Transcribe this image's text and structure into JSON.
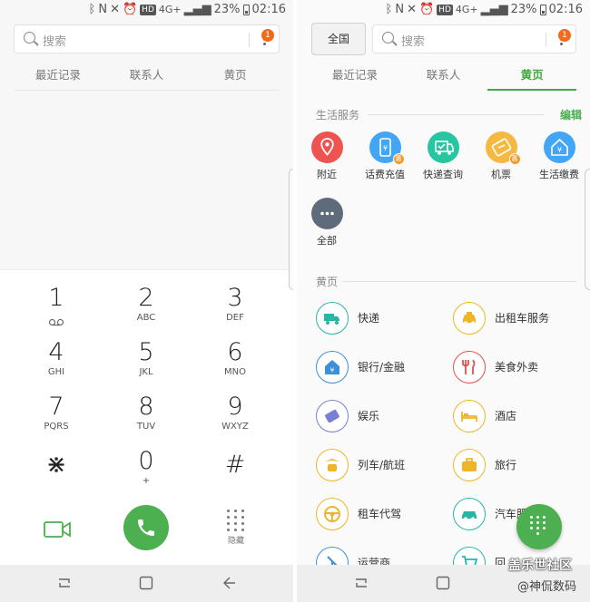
{
  "status": {
    "network": "4G+",
    "hd": "HD",
    "battery": "23%",
    "time": "02:16"
  },
  "search": {
    "placeholder": "搜索",
    "badge": "1"
  },
  "tabs": [
    {
      "label": "最近记录"
    },
    {
      "label": "联系人"
    },
    {
      "label": "黄页"
    }
  ],
  "dialpad": {
    "keys": [
      {
        "num": "1",
        "letters": ""
      },
      {
        "num": "2",
        "letters": "ABC"
      },
      {
        "num": "3",
        "letters": "DEF"
      },
      {
        "num": "4",
        "letters": "GHI"
      },
      {
        "num": "5",
        "letters": "JKL"
      },
      {
        "num": "6",
        "letters": "MNO"
      },
      {
        "num": "7",
        "letters": "PQRS"
      },
      {
        "num": "8",
        "letters": "TUV"
      },
      {
        "num": "9",
        "letters": "WXYZ"
      },
      {
        "num": "⋇",
        "letters": ""
      },
      {
        "num": "0",
        "letters": "+"
      },
      {
        "num": "#",
        "letters": ""
      }
    ],
    "hide_label": "隐藏"
  },
  "right": {
    "region_button": "全国",
    "life_services_title": "生活服务",
    "edit_label": "编辑",
    "services": [
      {
        "label": "附近",
        "icon": "location-pin-icon",
        "color": "#ef5350"
      },
      {
        "label": "话费充值",
        "icon": "phone-topup-icon",
        "color": "#42a5f5",
        "promo": "惠"
      },
      {
        "label": "快递查询",
        "icon": "delivery-truck-icon",
        "color": "#26c6a0"
      },
      {
        "label": "机票",
        "icon": "plane-ticket-icon",
        "color": "#f5b942",
        "promo": "惠"
      },
      {
        "label": "生活缴费",
        "icon": "home-bill-icon",
        "color": "#42a5f5"
      },
      {
        "label": "全部",
        "icon": "more-dots-icon",
        "color": "#5f6b7a"
      }
    ],
    "yellow_pages_title": "黄页",
    "yellow_pages": [
      {
        "label": "快递",
        "icon": "truck-icon",
        "color": "#26b6a6"
      },
      {
        "label": "出租车服务",
        "icon": "taxi-icon",
        "color": "#f0b429"
      },
      {
        "label": "银行/金融",
        "icon": "bank-icon",
        "color": "#3f8fd8"
      },
      {
        "label": "美食外卖",
        "icon": "fork-knife-icon",
        "color": "#e05050"
      },
      {
        "label": "娱乐",
        "icon": "ticket-icon",
        "color": "#7a7fd6"
      },
      {
        "label": "酒店",
        "icon": "bed-icon",
        "color": "#f0b429"
      },
      {
        "label": "列车/航班",
        "icon": "train-plane-icon",
        "color": "#f0b429"
      },
      {
        "label": "旅行",
        "icon": "suitcase-icon",
        "color": "#f0b429"
      },
      {
        "label": "租车代驾",
        "icon": "steering-wheel-icon",
        "color": "#f0b429"
      },
      {
        "label": "汽车服",
        "icon": "car-icon",
        "color": "#26b6a6"
      },
      {
        "label": "运营商",
        "icon": "antenna-icon",
        "color": "#3f8fd8"
      },
      {
        "label": "回",
        "icon": "cart-icon",
        "color": "#26b6a6"
      }
    ]
  },
  "watermark": {
    "line1": "盖乐世社区",
    "line2": "@神侃数码"
  }
}
